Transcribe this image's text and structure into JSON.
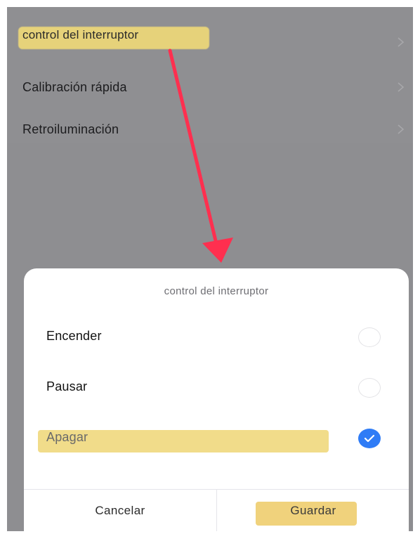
{
  "settings": {
    "items": [
      {
        "label": "control del interruptor",
        "icon": "chevron-right-icon"
      },
      {
        "label": "Calibración rápida",
        "icon": "chevron-right-icon"
      },
      {
        "label": "Retroiluminación",
        "icon": "chevron-right-icon"
      }
    ]
  },
  "dialog": {
    "title": "control del interruptor",
    "options": [
      {
        "label": "Encender",
        "selected": false
      },
      {
        "label": "Pausar",
        "selected": false
      },
      {
        "label": "Apagar",
        "selected": true
      }
    ],
    "cancel_label": "Cancelar",
    "save_label": "Guardar"
  },
  "colors": {
    "accent": "#2f7cf6",
    "highlight": "#f1dc8a",
    "annotation_arrow": "#ff2f4f",
    "overlay": "#8e8e91"
  }
}
